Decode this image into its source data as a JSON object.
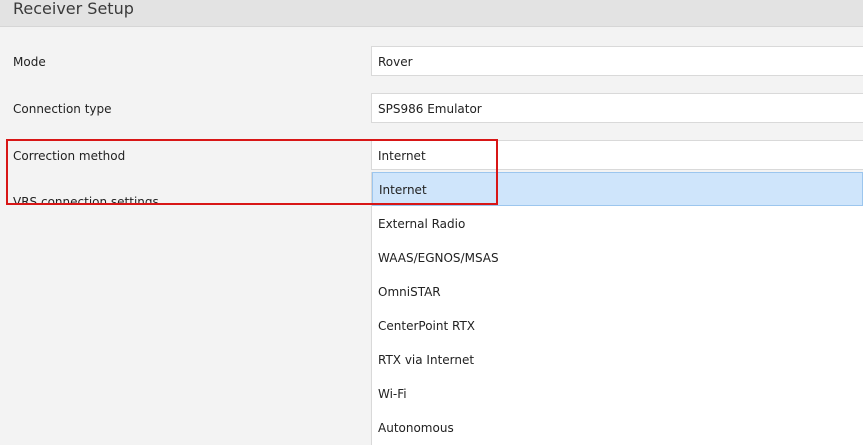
{
  "header": {
    "title": "Receiver Setup"
  },
  "form": {
    "mode": {
      "label": "Mode",
      "value": "Rover"
    },
    "connection_type": {
      "label": "Connection type",
      "value": "SPS986 Emulator"
    },
    "correction_method": {
      "label": "Correction method",
      "value": "Internet"
    },
    "vrs_settings": {
      "label": "VRS connection settings"
    }
  },
  "dropdown": {
    "options": [
      "Internet",
      "External Radio",
      "WAAS/EGNOS/MSAS",
      "OmniSTAR",
      "CenterPoint RTX",
      "RTX via Internet",
      "Wi-Fi",
      "Autonomous"
    ],
    "selected": "Internet"
  },
  "annotation": {
    "color": "#d81616"
  }
}
